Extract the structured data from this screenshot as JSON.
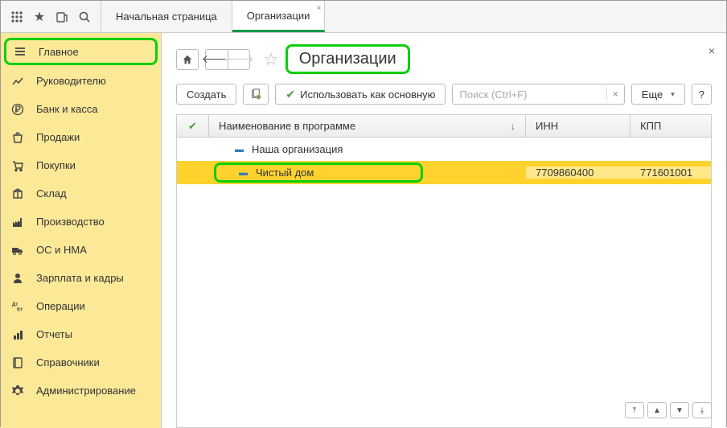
{
  "tabs": {
    "home": "Начальная страница",
    "orgs": "Организации"
  },
  "sidebar": {
    "items": [
      {
        "label": "Главное"
      },
      {
        "label": "Руководителю"
      },
      {
        "label": "Банк и касса"
      },
      {
        "label": "Продажи"
      },
      {
        "label": "Покупки"
      },
      {
        "label": "Склад"
      },
      {
        "label": "Производство"
      },
      {
        "label": "ОС и НМА"
      },
      {
        "label": "Зарплата и кадры"
      },
      {
        "label": "Операции"
      },
      {
        "label": "Отчеты"
      },
      {
        "label": "Справочники"
      },
      {
        "label": "Администрирование"
      }
    ]
  },
  "page": {
    "title": "Организации"
  },
  "toolbar": {
    "create": "Создать",
    "use_main": "Использовать как основную",
    "search_placeholder": "Поиск (Ctrl+F)",
    "more": "Еще",
    "help": "?"
  },
  "table": {
    "headers": {
      "name": "Наименование в программе",
      "inn": "ИНН",
      "kpp": "КПП"
    },
    "rows": [
      {
        "name": "Наша организация",
        "inn": "",
        "kpp": ""
      },
      {
        "name": "Чистый дом",
        "inn": "7709860400",
        "kpp": "771601001"
      }
    ]
  }
}
